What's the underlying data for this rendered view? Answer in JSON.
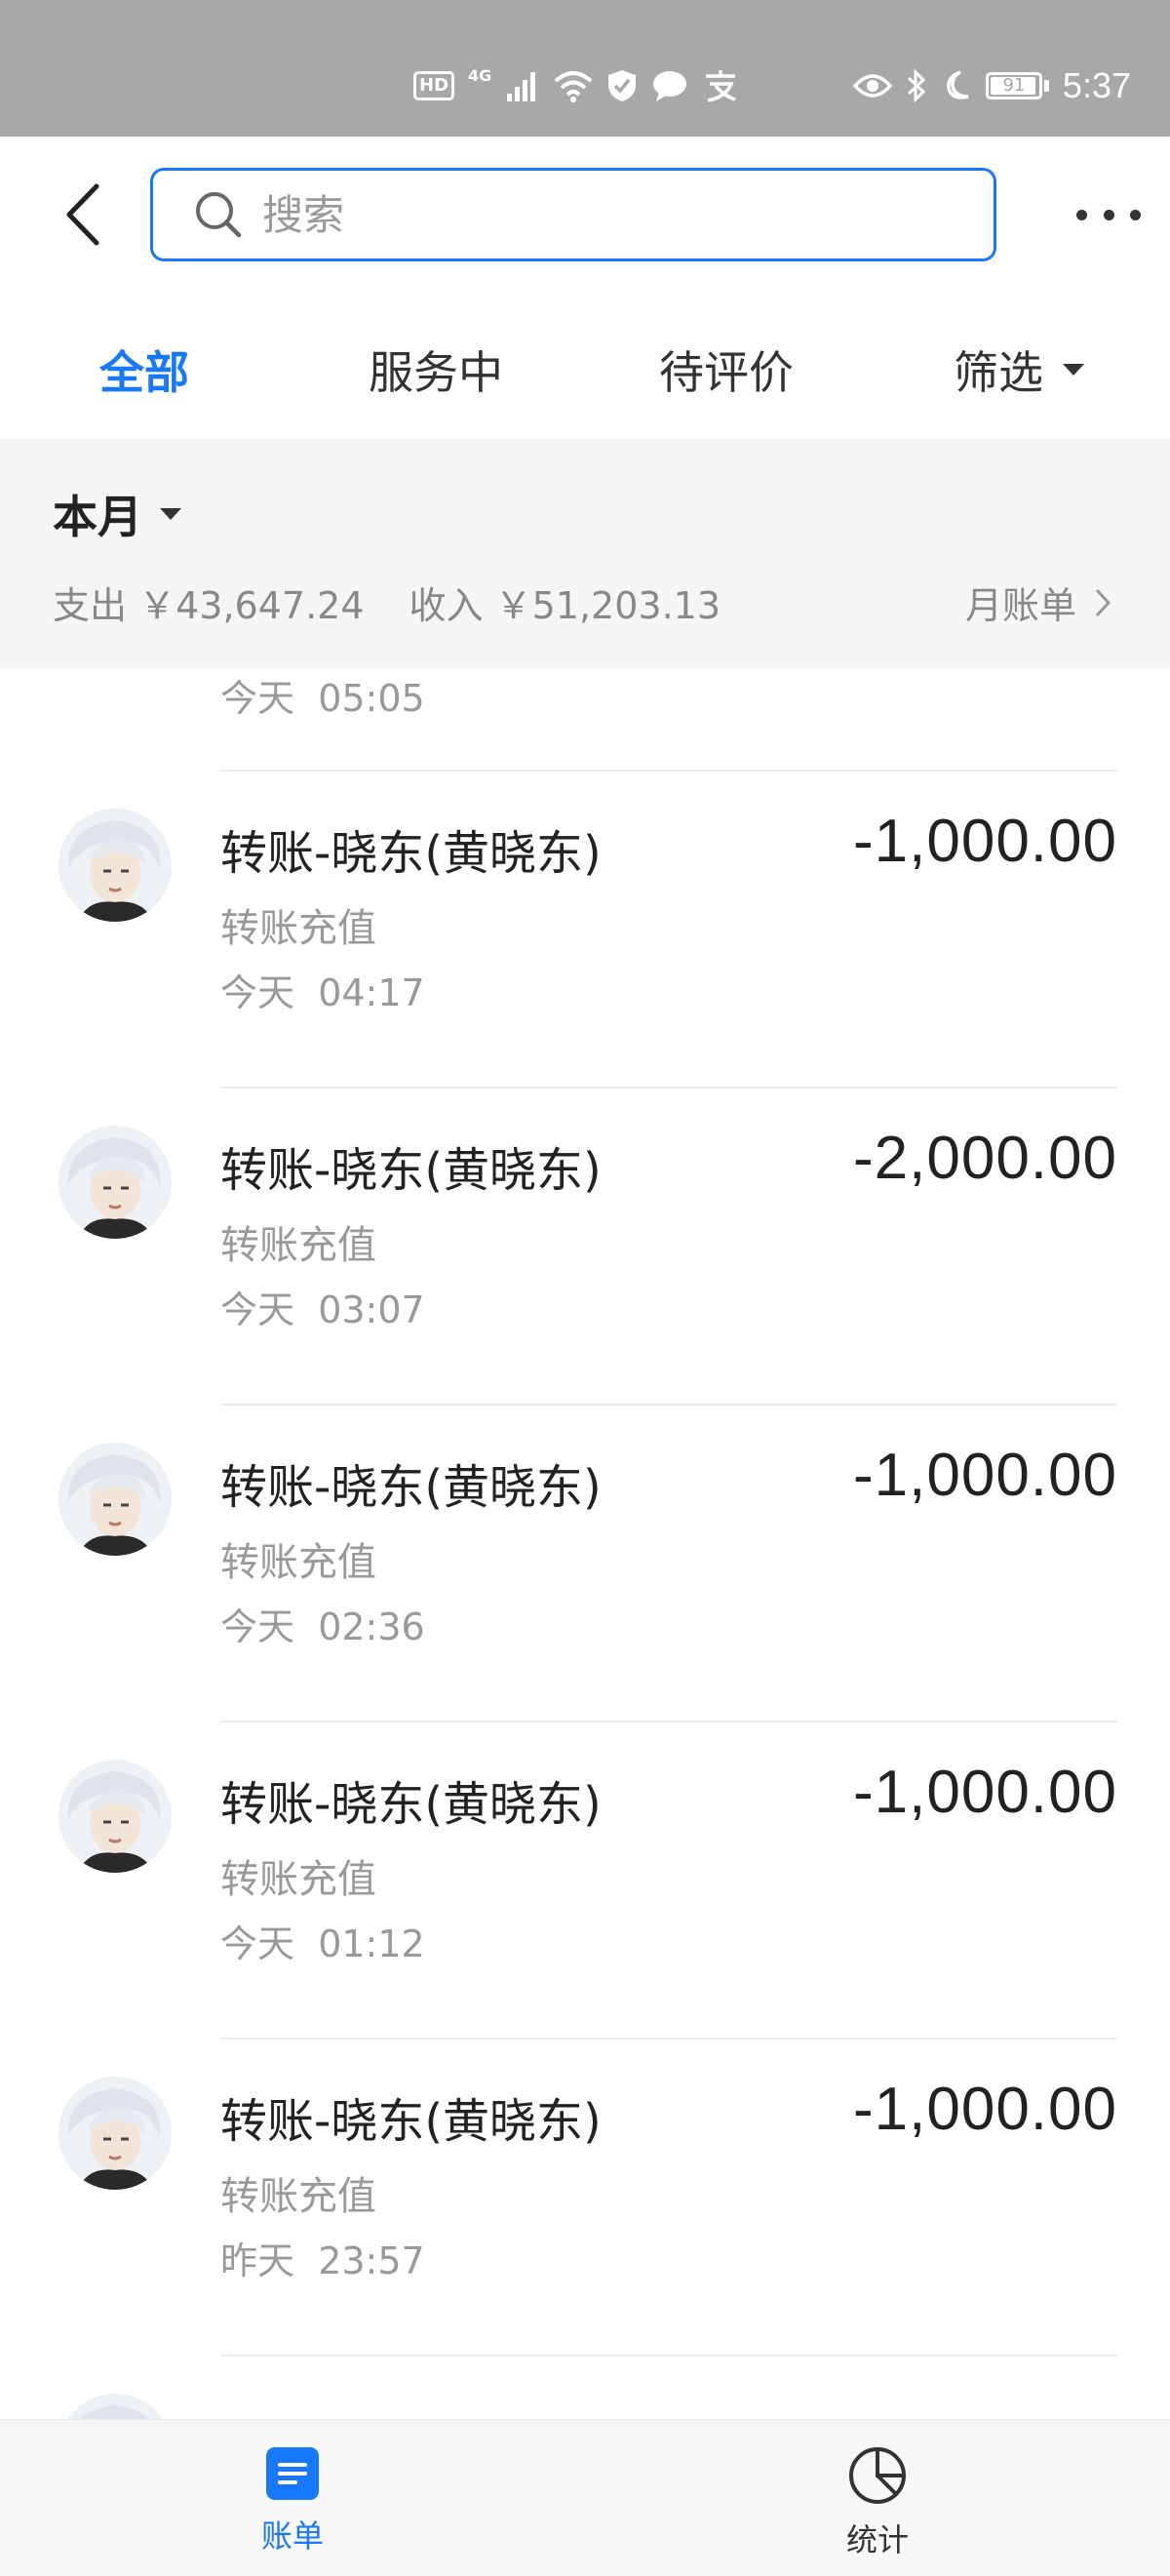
{
  "status_bar": {
    "hd": "HD",
    "network": "4G",
    "battery": "91",
    "time": "5:37",
    "icons": [
      "signal-icon",
      "wifi-icon",
      "shield-icon",
      "chat-bubble-icon",
      "alipay-icon",
      "eye-icon",
      "bluetooth-icon",
      "moon-icon",
      "battery-icon"
    ]
  },
  "header": {
    "search_placeholder": "搜索"
  },
  "tabs": [
    {
      "label": "全部",
      "active": true
    },
    {
      "label": "服务中",
      "active": false
    },
    {
      "label": "待评价",
      "active": false
    },
    {
      "label": "筛选",
      "active": false
    }
  ],
  "month": {
    "label": "本月",
    "expense_label": "支出",
    "expense": "￥43,647.24",
    "income_label": "收入",
    "income": "￥51,203.13",
    "bill_link": "月账单"
  },
  "partial_top": {
    "day": "今天",
    "time": "05:05"
  },
  "transactions": [
    {
      "title": "转账-晓东(黄晓东)",
      "subtitle": "转账充值",
      "day": "今天",
      "time": "04:17",
      "amount": "-1,000.00"
    },
    {
      "title": "转账-晓东(黄晓东)",
      "subtitle": "转账充值",
      "day": "今天",
      "time": "03:07",
      "amount": "-2,000.00"
    },
    {
      "title": "转账-晓东(黄晓东)",
      "subtitle": "转账充值",
      "day": "今天",
      "time": "02:36",
      "amount": "-1,000.00"
    },
    {
      "title": "转账-晓东(黄晓东)",
      "subtitle": "转账充值",
      "day": "今天",
      "time": "01:12",
      "amount": "-1,000.00"
    },
    {
      "title": "转账-晓东(黄晓东)",
      "subtitle": "转账充值",
      "day": "昨天",
      "time": "23:57",
      "amount": "-1,000.00"
    }
  ],
  "bottom_nav": [
    {
      "label": "账单",
      "active": true,
      "icon": "bill-icon"
    },
    {
      "label": "统计",
      "active": false,
      "icon": "pie-chart-icon"
    }
  ],
  "colors": {
    "accent": "#1677ff",
    "status_bar": "#a8a8a8",
    "section_bg": "#f5f5f5"
  }
}
